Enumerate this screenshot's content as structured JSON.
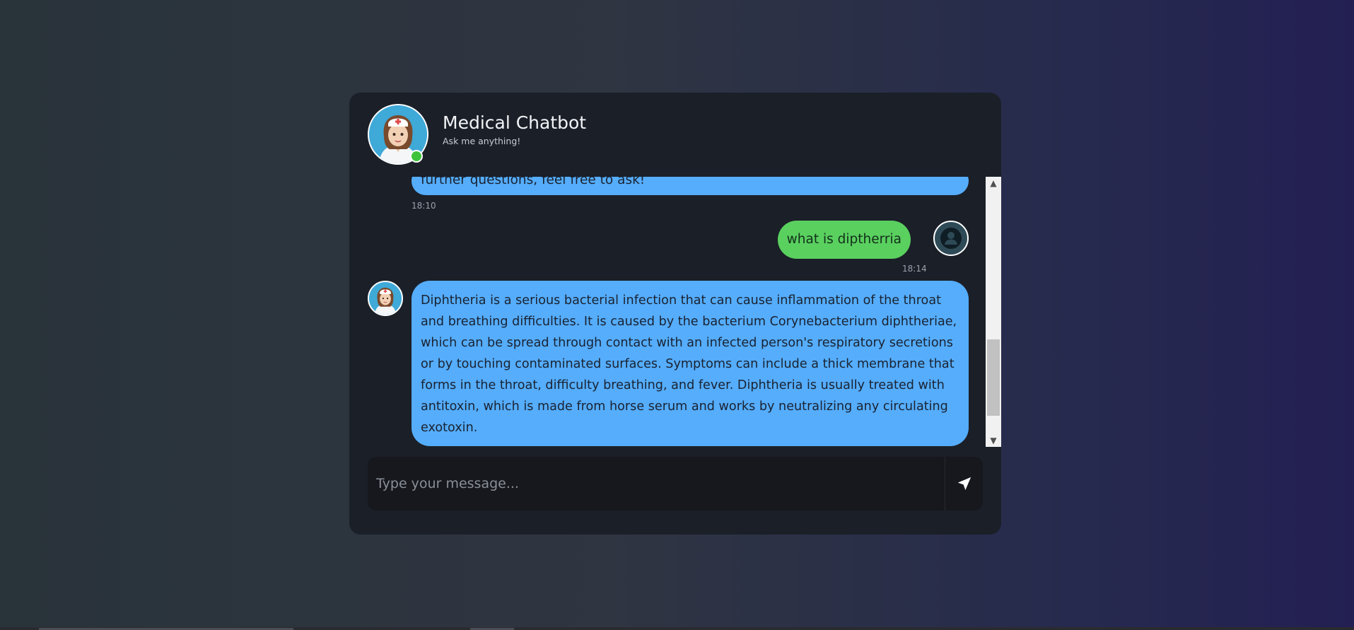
{
  "header": {
    "title": "Medical Chatbot",
    "subtitle": "Ask me anything!"
  },
  "messages": [
    {
      "sender": "bot",
      "text": "further questions, feel free to ask!",
      "time": "18:10"
    },
    {
      "sender": "user",
      "text": "what is diptherria",
      "time": "18:14"
    },
    {
      "sender": "bot",
      "text": "Diphtheria is a serious bacterial infection that can cause inflammation of the throat and breathing difficulties. It is caused by the bacterium Corynebacterium diphtheriae, which can be spread through contact with an infected person's respiratory secretions or by touching contaminated surfaces. Symptoms can include a thick membrane that forms in the throat, difficulty breathing, and fever. Diphtheria is usually treated with antitoxin, which is made from horse serum and works by neutralizing any circulating exotoxin."
    }
  ],
  "input": {
    "placeholder": "Type your message...",
    "value": ""
  },
  "icons": {
    "send": "paper-plane-icon",
    "user": "user-icon",
    "scroll_up": "arrow-up-icon",
    "scroll_down": "arrow-down-icon"
  },
  "colors": {
    "bot_bubble": "#55adfc",
    "user_bubble": "#5ad05f",
    "online": "#3ec33a",
    "card": "#1b1f28"
  }
}
